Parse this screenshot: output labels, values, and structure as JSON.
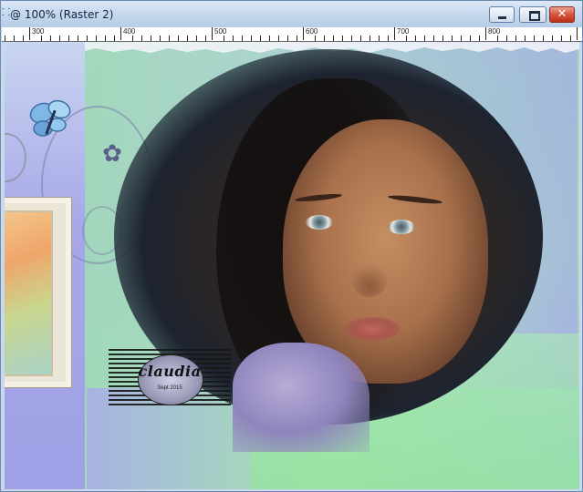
{
  "window": {
    "title": "@ 100% (Raster 2)",
    "title_icon": "document-icon",
    "controls": {
      "minimize": "minimize-icon",
      "maximize": "maximize-icon",
      "close": "close-icon",
      "close_glyph": "✕"
    }
  },
  "ruler": {
    "labels": [
      "300",
      "400",
      "500",
      "600",
      "700",
      "800"
    ]
  },
  "canvas": {
    "zoom": "100%",
    "layer": "Raster 2",
    "decorations": {
      "flower_glyph": "✿",
      "butterfly": "butterfly-icon"
    },
    "watermark": {
      "text": "claudia",
      "subtext": "Sept 2015"
    }
  },
  "colors": {
    "titlebar": "#c6d8ee",
    "close_button": "#d3533b",
    "canvas_green": "#a9e7b0",
    "canvas_violet": "#a3a6ea"
  }
}
